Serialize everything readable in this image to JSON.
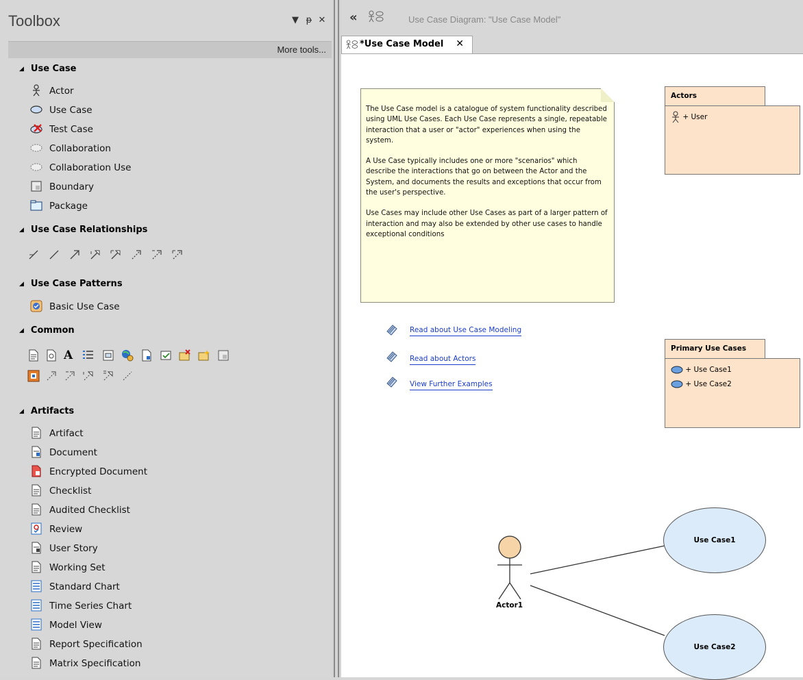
{
  "toolbox": {
    "title": "Toolbox",
    "more_tools": "More tools...",
    "sections": {
      "use_case": {
        "title": "Use Case",
        "items": [
          "Actor",
          "Use Case",
          "Test Case",
          "Collaboration",
          "Collaboration Use",
          "Boundary",
          "Package"
        ]
      },
      "relationships": {
        "title": "Use Case Relationships"
      },
      "patterns": {
        "title": "Use Case Patterns",
        "items": [
          "Basic Use Case"
        ]
      },
      "common": {
        "title": "Common"
      },
      "artifacts": {
        "title": "Artifacts",
        "items": [
          "Artifact",
          "Document",
          "Encrypted Document",
          "Checklist",
          "Audited Checklist",
          "Review",
          "User Story",
          "Working Set",
          "Standard Chart",
          "Time Series Chart",
          "Model View",
          "Report Specification",
          "Matrix Specification"
        ]
      }
    }
  },
  "diagram_window": {
    "title": "Use Case Diagram: \"Use Case Model\"",
    "tab_label": "*Use Case Model"
  },
  "diagram": {
    "note_paragraphs": [
      "The Use Case model is a catalogue of system functionality described using UML Use Cases. Each Use Case represents a single, repeatable interaction that a user or \"actor\" experiences when using the system.",
      "A Use Case typically includes one or more \"scenarios\" which describe the interactions that go on between the Actor and the System, and documents the results and exceptions that occur from the user's perspective.",
      "Use Cases may include other Use Cases as part of a larger pattern of interaction and may also be extended by other use cases to handle exceptional conditions"
    ],
    "links": [
      "Read about Use Case Modeling",
      "Read about Actors",
      "View Further Examples"
    ],
    "actors_package": {
      "name": "Actors",
      "items": [
        "+ User"
      ]
    },
    "primary_package": {
      "name": "Primary Use Cases",
      "items": [
        "+ Use Case1",
        "+ Use Case2"
      ]
    },
    "actor_name": "Actor1",
    "use_case_1": "Use Case1",
    "use_case_2": "Use Case2"
  },
  "colors": {
    "note_fill": "#ffffe0",
    "package_fill": "#fde3c9",
    "usecase_fill": "#dcebfa",
    "actor_head": "#f7d4a7",
    "link": "#1a3cc9"
  }
}
